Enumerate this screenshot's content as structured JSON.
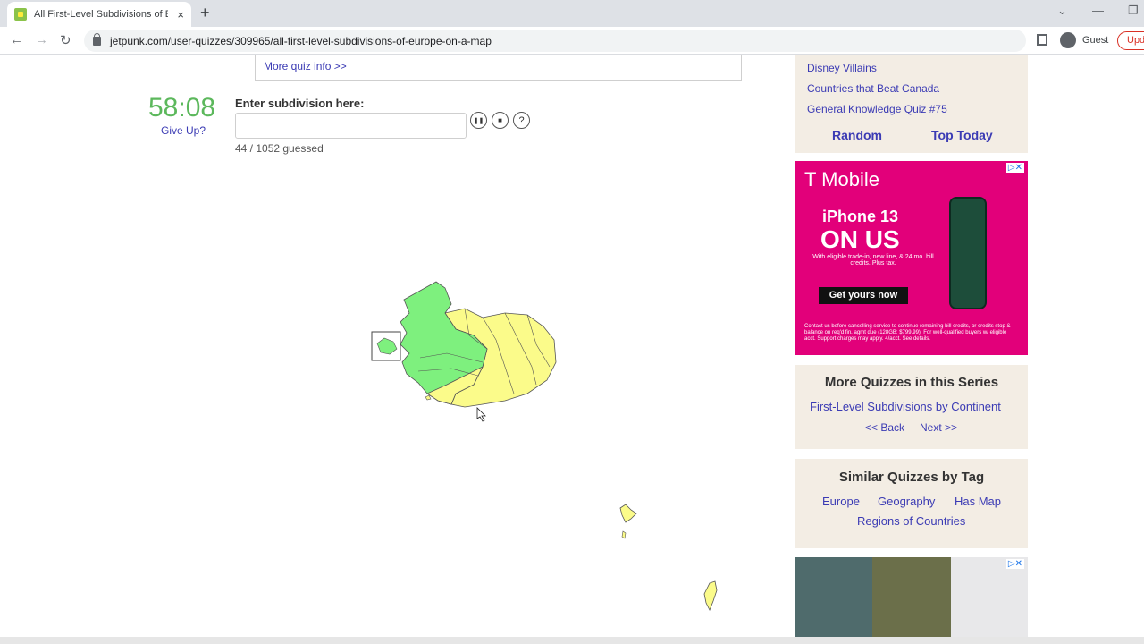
{
  "browser": {
    "tab_title": "All First-Level Subdivisions of Europe",
    "tab_close": "×",
    "new_tab": "+",
    "url": "jetpunk.com/user-quizzes/309965/all-first-level-subdivisions-of-europe-on-a-map",
    "guest_label": "Guest",
    "update_label": "Upd",
    "back": "←",
    "forward": "→",
    "reload": "↻",
    "chevron": "⌄",
    "minimize": "—",
    "restore": "❐"
  },
  "quiz": {
    "more_info": "More quiz info >>",
    "timer": "58:08",
    "give_up": "Give Up?",
    "enter_label": "Enter subdivision here:",
    "input_value": "",
    "guessed": "44 / 1052 guessed",
    "pause_icon": "❚❚",
    "stop_icon": "■",
    "help_icon": "?"
  },
  "sidebar": {
    "related_links": [
      "Disney Villains",
      "Countries that Beat Canada",
      "General Knowledge Quiz #75"
    ],
    "random": "Random",
    "top_today": "Top Today",
    "series_title": "More Quizzes in this Series",
    "series_link": "First-Level Subdivisions by Continent",
    "back": "<< Back",
    "next": "Next >>",
    "tag_title": "Similar Quizzes by Tag",
    "tags": [
      "Europe",
      "Geography",
      "Has Map",
      "Regions of Countries"
    ]
  },
  "ad": {
    "brand": "T Mobile",
    "headline1": "iPhone 13",
    "headline2": "ON US",
    "subtext": "With eligible trade-in, new line, & 24 mo. bill credits. Plus tax.",
    "cta": "Get yours now",
    "fine_print": "Contact us before cancelling service to continue remaining bill credits, or credits stop & balance on req'd fin. agmt due (128GB: $799.99). For well-qualified buyers w/ eligible acct. Support charges may apply. 4/acct. See details.",
    "close": "▷✕"
  },
  "colors": {
    "timer_green": "#5cb85c",
    "link_blue": "#3b3bb4",
    "map_guessed": "#7ef07e",
    "map_unguessed": "#fbfb8a",
    "sidebar_bg": "#f3ede4",
    "ad_magenta": "#e2007a"
  }
}
